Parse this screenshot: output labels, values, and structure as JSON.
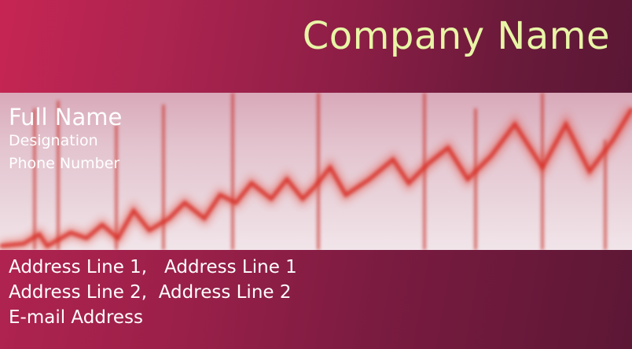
{
  "card": {
    "company_name": "Company Name",
    "full_name": "Full Name",
    "designation": "Designation",
    "phone": "Phone Number",
    "address_line_1": "Address Line 1,   Address Line 1",
    "address_line_2": "Address Line 2,  Address Line 2",
    "email": "E-mail Address"
  },
  "colors": {
    "company_name_text": "#e8f5a6",
    "card_background": "#8e1f47",
    "ekg_trace": "#d8332b",
    "body_text": "#ffffff"
  },
  "background_image": "ekg-heartbeat-trace"
}
